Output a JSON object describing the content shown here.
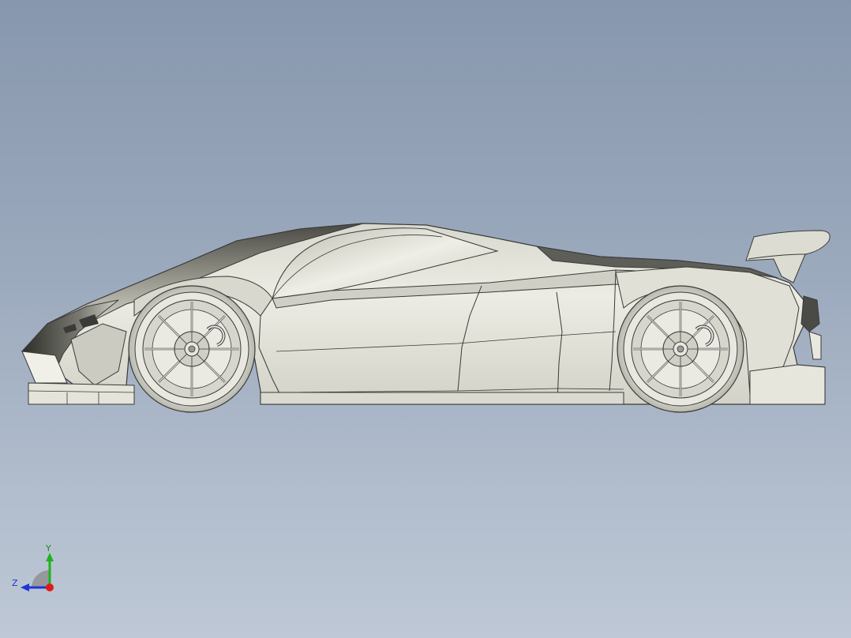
{
  "viewport": {
    "background_top": "#8797ad",
    "background_bottom": "#bec8d6"
  },
  "model": {
    "body_color": "#e2e2d8",
    "edge_color": "#3a3a3a",
    "shadow_color": "#5a5a55"
  },
  "triad": {
    "y_label": "Y",
    "z_label": "Z",
    "y_color": "#1db31d",
    "z_color": "#2035d6",
    "x_color": "#e01a1a"
  }
}
